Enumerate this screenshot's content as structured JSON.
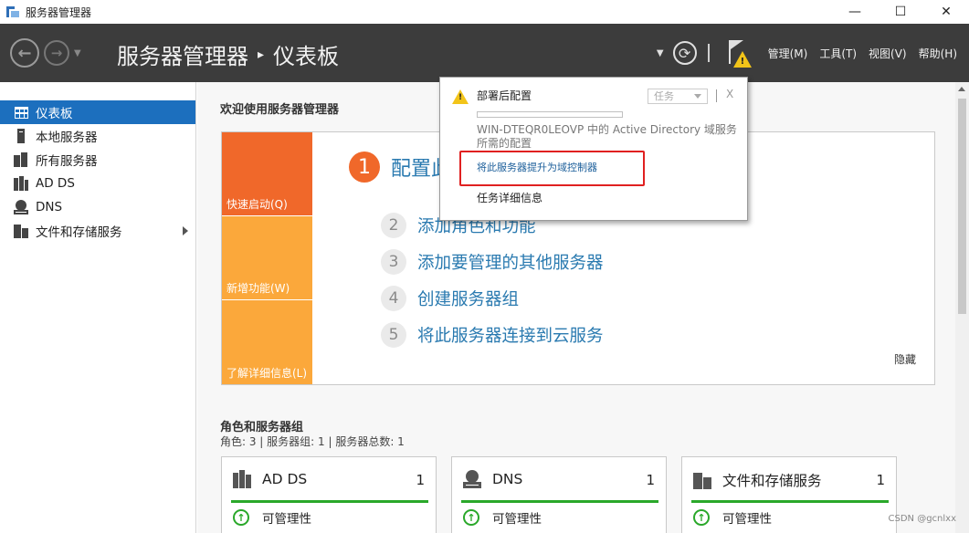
{
  "window": {
    "title": "服务器管理器",
    "controls": {
      "minimize": "—",
      "maximize": "☐",
      "close": "✕"
    }
  },
  "header": {
    "breadcrumb_root": "服务器管理器",
    "breadcrumb_sep": "▸",
    "breadcrumb_current": "仪表板",
    "menus": [
      "管理(M)",
      "工具(T)",
      "视图(V)",
      "帮助(H)"
    ]
  },
  "sidebar": {
    "items": [
      {
        "label": "仪表板",
        "icon": "dashboard-icon",
        "active": true
      },
      {
        "label": "本地服务器",
        "icon": "local-server-icon"
      },
      {
        "label": "所有服务器",
        "icon": "all-servers-icon"
      },
      {
        "label": "AD DS",
        "icon": "adds-icon"
      },
      {
        "label": "DNS",
        "icon": "dns-icon"
      },
      {
        "label": "文件和存储服务",
        "icon": "file-storage-icon",
        "has_children": true
      }
    ]
  },
  "welcome": {
    "title": "欢迎使用服务器管理器",
    "tiles": [
      "快速启动(Q)",
      "新增功能(W)",
      "了解详细信息(L)"
    ],
    "steps": [
      {
        "num": "1",
        "label": "配置此本地服务器"
      },
      {
        "num": "2",
        "label": "添加角色和功能"
      },
      {
        "num": "3",
        "label": "添加要管理的其他服务器"
      },
      {
        "num": "4",
        "label": "创建服务器组"
      },
      {
        "num": "5",
        "label": "将此服务器连接到云服务"
      }
    ],
    "hide": "隐藏"
  },
  "roles": {
    "title": "角色和服务器组",
    "summary": "角色: 3 | 服务器组: 1 | 服务器总数: 1",
    "cards": [
      {
        "name": "AD DS",
        "count": "1",
        "status": "可管理性",
        "icon": "adds-icon"
      },
      {
        "name": "DNS",
        "count": "1",
        "status": "可管理性",
        "icon": "dns-icon"
      },
      {
        "name": "文件和存储服务",
        "count": "1",
        "status": "可管理性",
        "icon": "file-storage-icon"
      }
    ]
  },
  "notification": {
    "title": "部署后配置",
    "task_button": "任务",
    "close": "X",
    "description": "WIN-DTEQR0LEOVP 中的 Active Directory 域服务所需的配置",
    "link": "将此服务器提升为域控制器",
    "details": "任务详细信息"
  },
  "watermark": "CSDN @gcnlxx",
  "colors": {
    "header_bg": "#3c3c3c",
    "accent_blue": "#1c6fbe",
    "quickstart_orange": "#f0682a",
    "tile_amber": "#fba83b",
    "status_green": "#2aa82a",
    "highlight_red": "#e02020"
  }
}
